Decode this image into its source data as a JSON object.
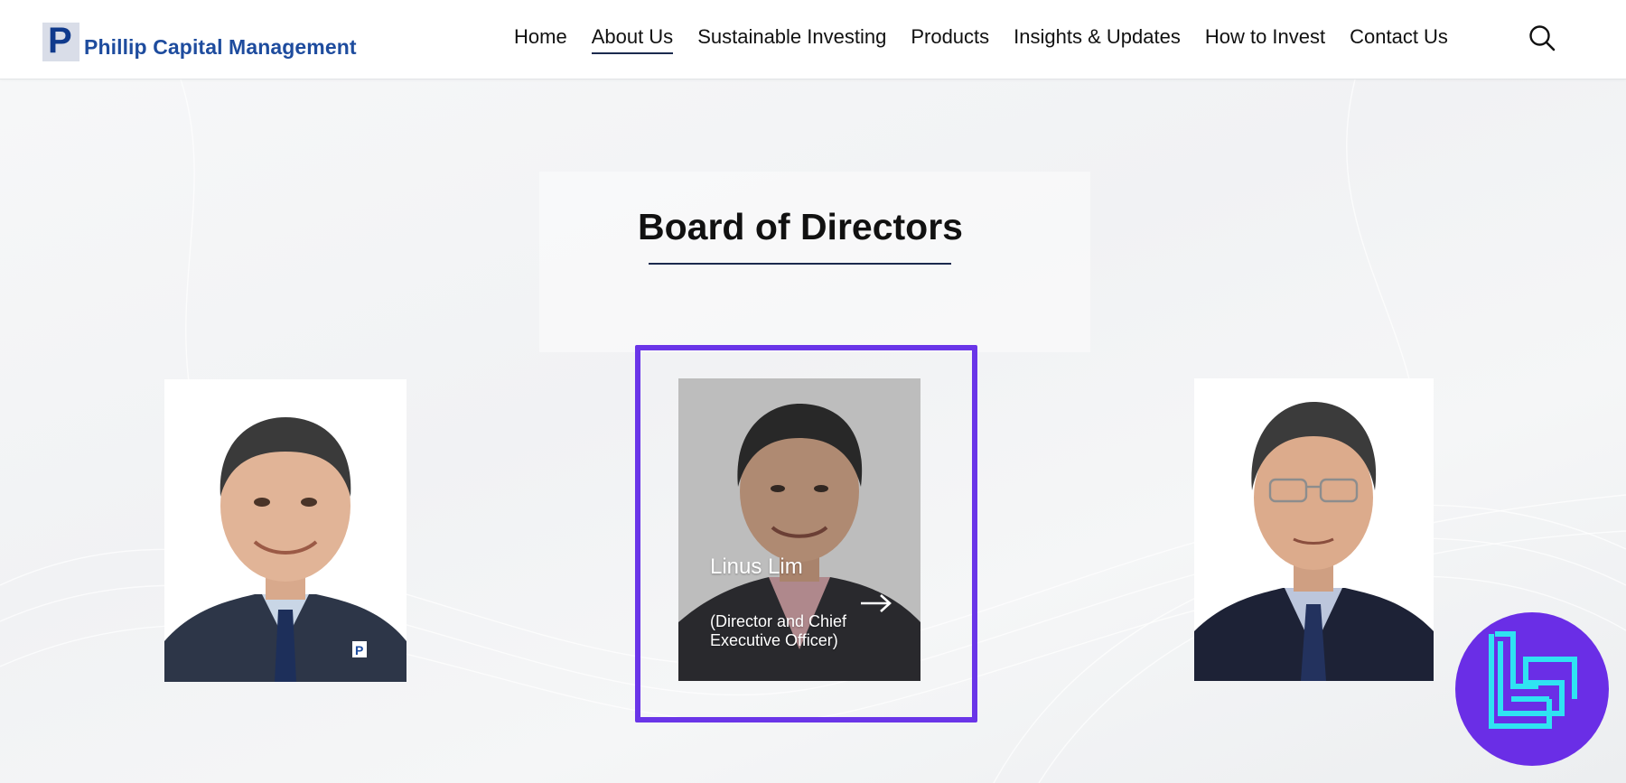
{
  "header": {
    "logo_letter": "P",
    "logo_text": "Phillip Capital Management",
    "nav": [
      {
        "label": "Home"
      },
      {
        "label": "About Us"
      },
      {
        "label": "Sustainable Investing"
      },
      {
        "label": "Products"
      },
      {
        "label": "Insights & Updates"
      },
      {
        "label": "How to Invest"
      },
      {
        "label": "Contact Us"
      }
    ],
    "active_nav": "About Us"
  },
  "section": {
    "title": "Board of Directors"
  },
  "directors": [
    {
      "name": "",
      "role": ""
    },
    {
      "name": "Linus Lim",
      "role": "(Director and Chief Executive Officer)"
    },
    {
      "name": "",
      "role": ""
    }
  ],
  "colors": {
    "accent": "#1b2a4e",
    "highlight": "#6a35e8",
    "brand_blue": "#1e4c9e",
    "badge": "#6a2ee6",
    "badge_logo": "#2fe3f2"
  }
}
